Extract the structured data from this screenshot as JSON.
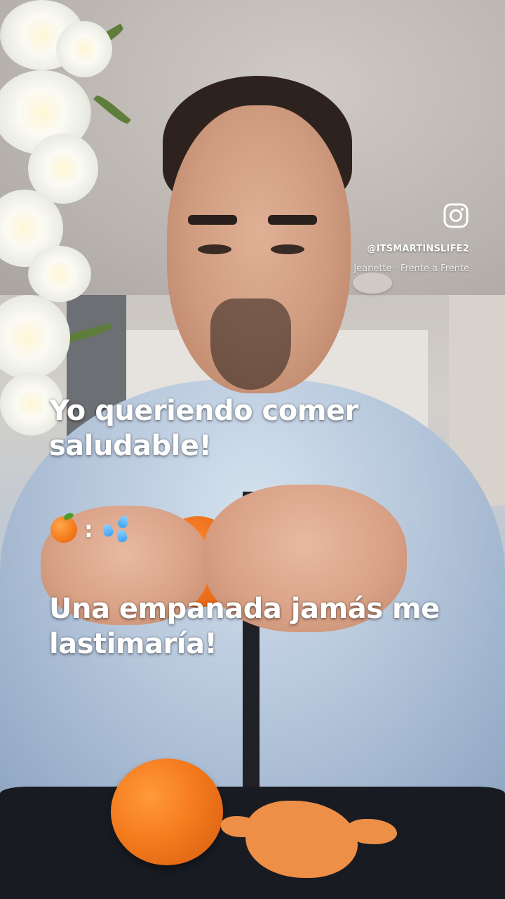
{
  "overlay": {
    "instagram_icon": "instagram-icon",
    "username": "@ITSMARTINSLIFE2",
    "music": "Jeanette · Frente a Frente"
  },
  "captions": {
    "line1": "Yo queriendo comer saludable!",
    "emoji_colon": ":",
    "line2": "Una empanada jamás me lastimaría!"
  },
  "emojis": [
    "tangerine-emoji",
    "sweat-droplets-emoji"
  ],
  "colors": {
    "caption_text": "#ffffff",
    "orange": "#f57b1d",
    "table": "#181b22"
  }
}
